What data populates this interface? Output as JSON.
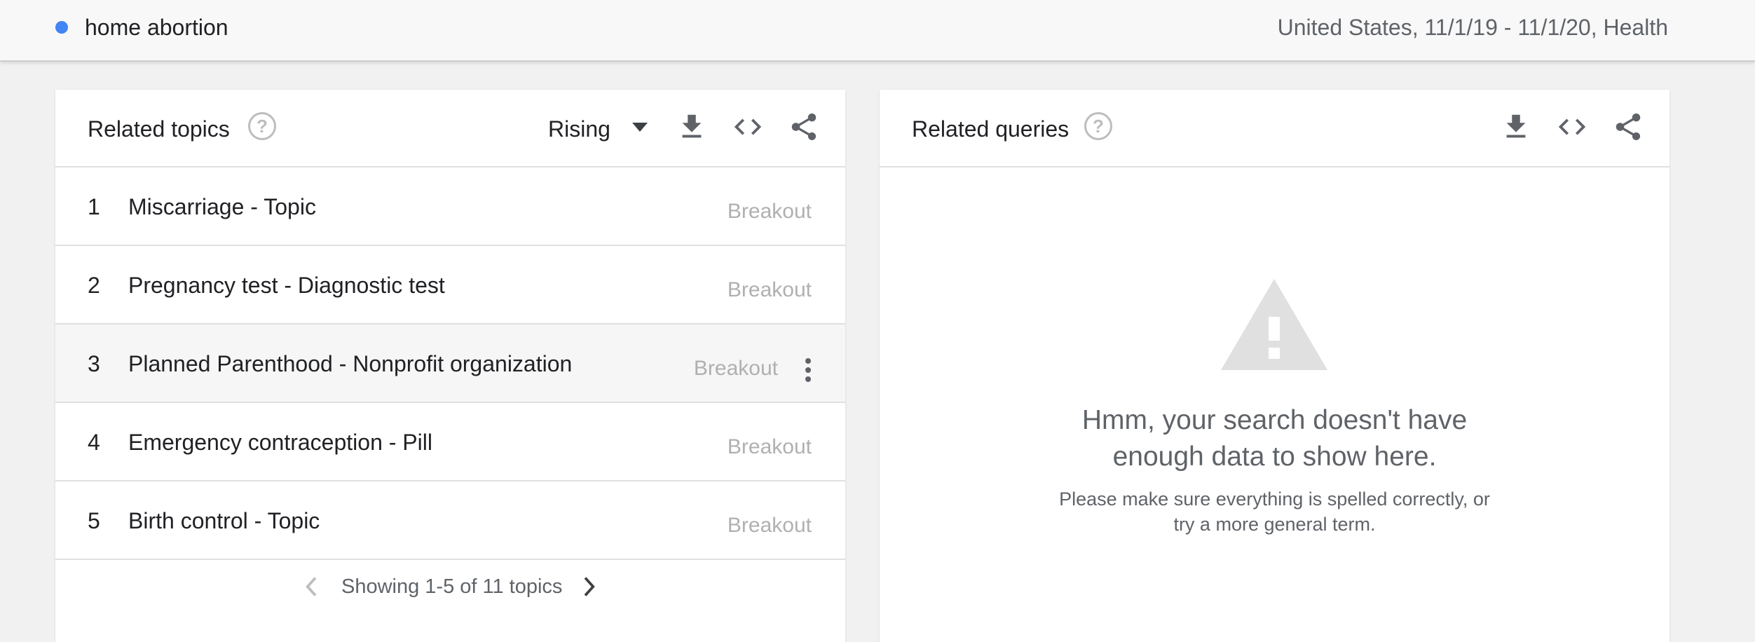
{
  "header": {
    "term": "home abortion",
    "term_color": "#4285f4",
    "meta": "United States, 11/1/19 - 11/1/20, Health"
  },
  "related_topics": {
    "title": "Related topics",
    "help_icon": "help-circle-icon",
    "filter_label": "Rising",
    "tools": [
      "download-icon",
      "embed-code-icon",
      "share-icon"
    ],
    "rows": [
      {
        "rank": "1",
        "label": "Miscarriage - Topic",
        "value": "Breakout"
      },
      {
        "rank": "2",
        "label": "Pregnancy test - Diagnostic test",
        "value": "Breakout"
      },
      {
        "rank": "3",
        "label": "Planned Parenthood - Nonprofit organization",
        "value": "Breakout"
      },
      {
        "rank": "4",
        "label": "Emergency contraception - Pill",
        "value": "Breakout"
      },
      {
        "rank": "5",
        "label": "Birth control - Topic",
        "value": "Breakout"
      }
    ],
    "pager_text": "Showing 1-5 of 11 topics"
  },
  "related_queries": {
    "title": "Related queries",
    "help_icon": "help-circle-icon",
    "tools": [
      "download-icon",
      "embed-code-icon",
      "share-icon"
    ],
    "empty_icon": "warning-triangle-icon",
    "empty_title_line1": "Hmm, your search doesn't have",
    "empty_title_line2": "enough data to show here.",
    "empty_sub_line1": "Please make sure everything is spelled correctly, or",
    "empty_sub_line2": "try a more general term."
  }
}
